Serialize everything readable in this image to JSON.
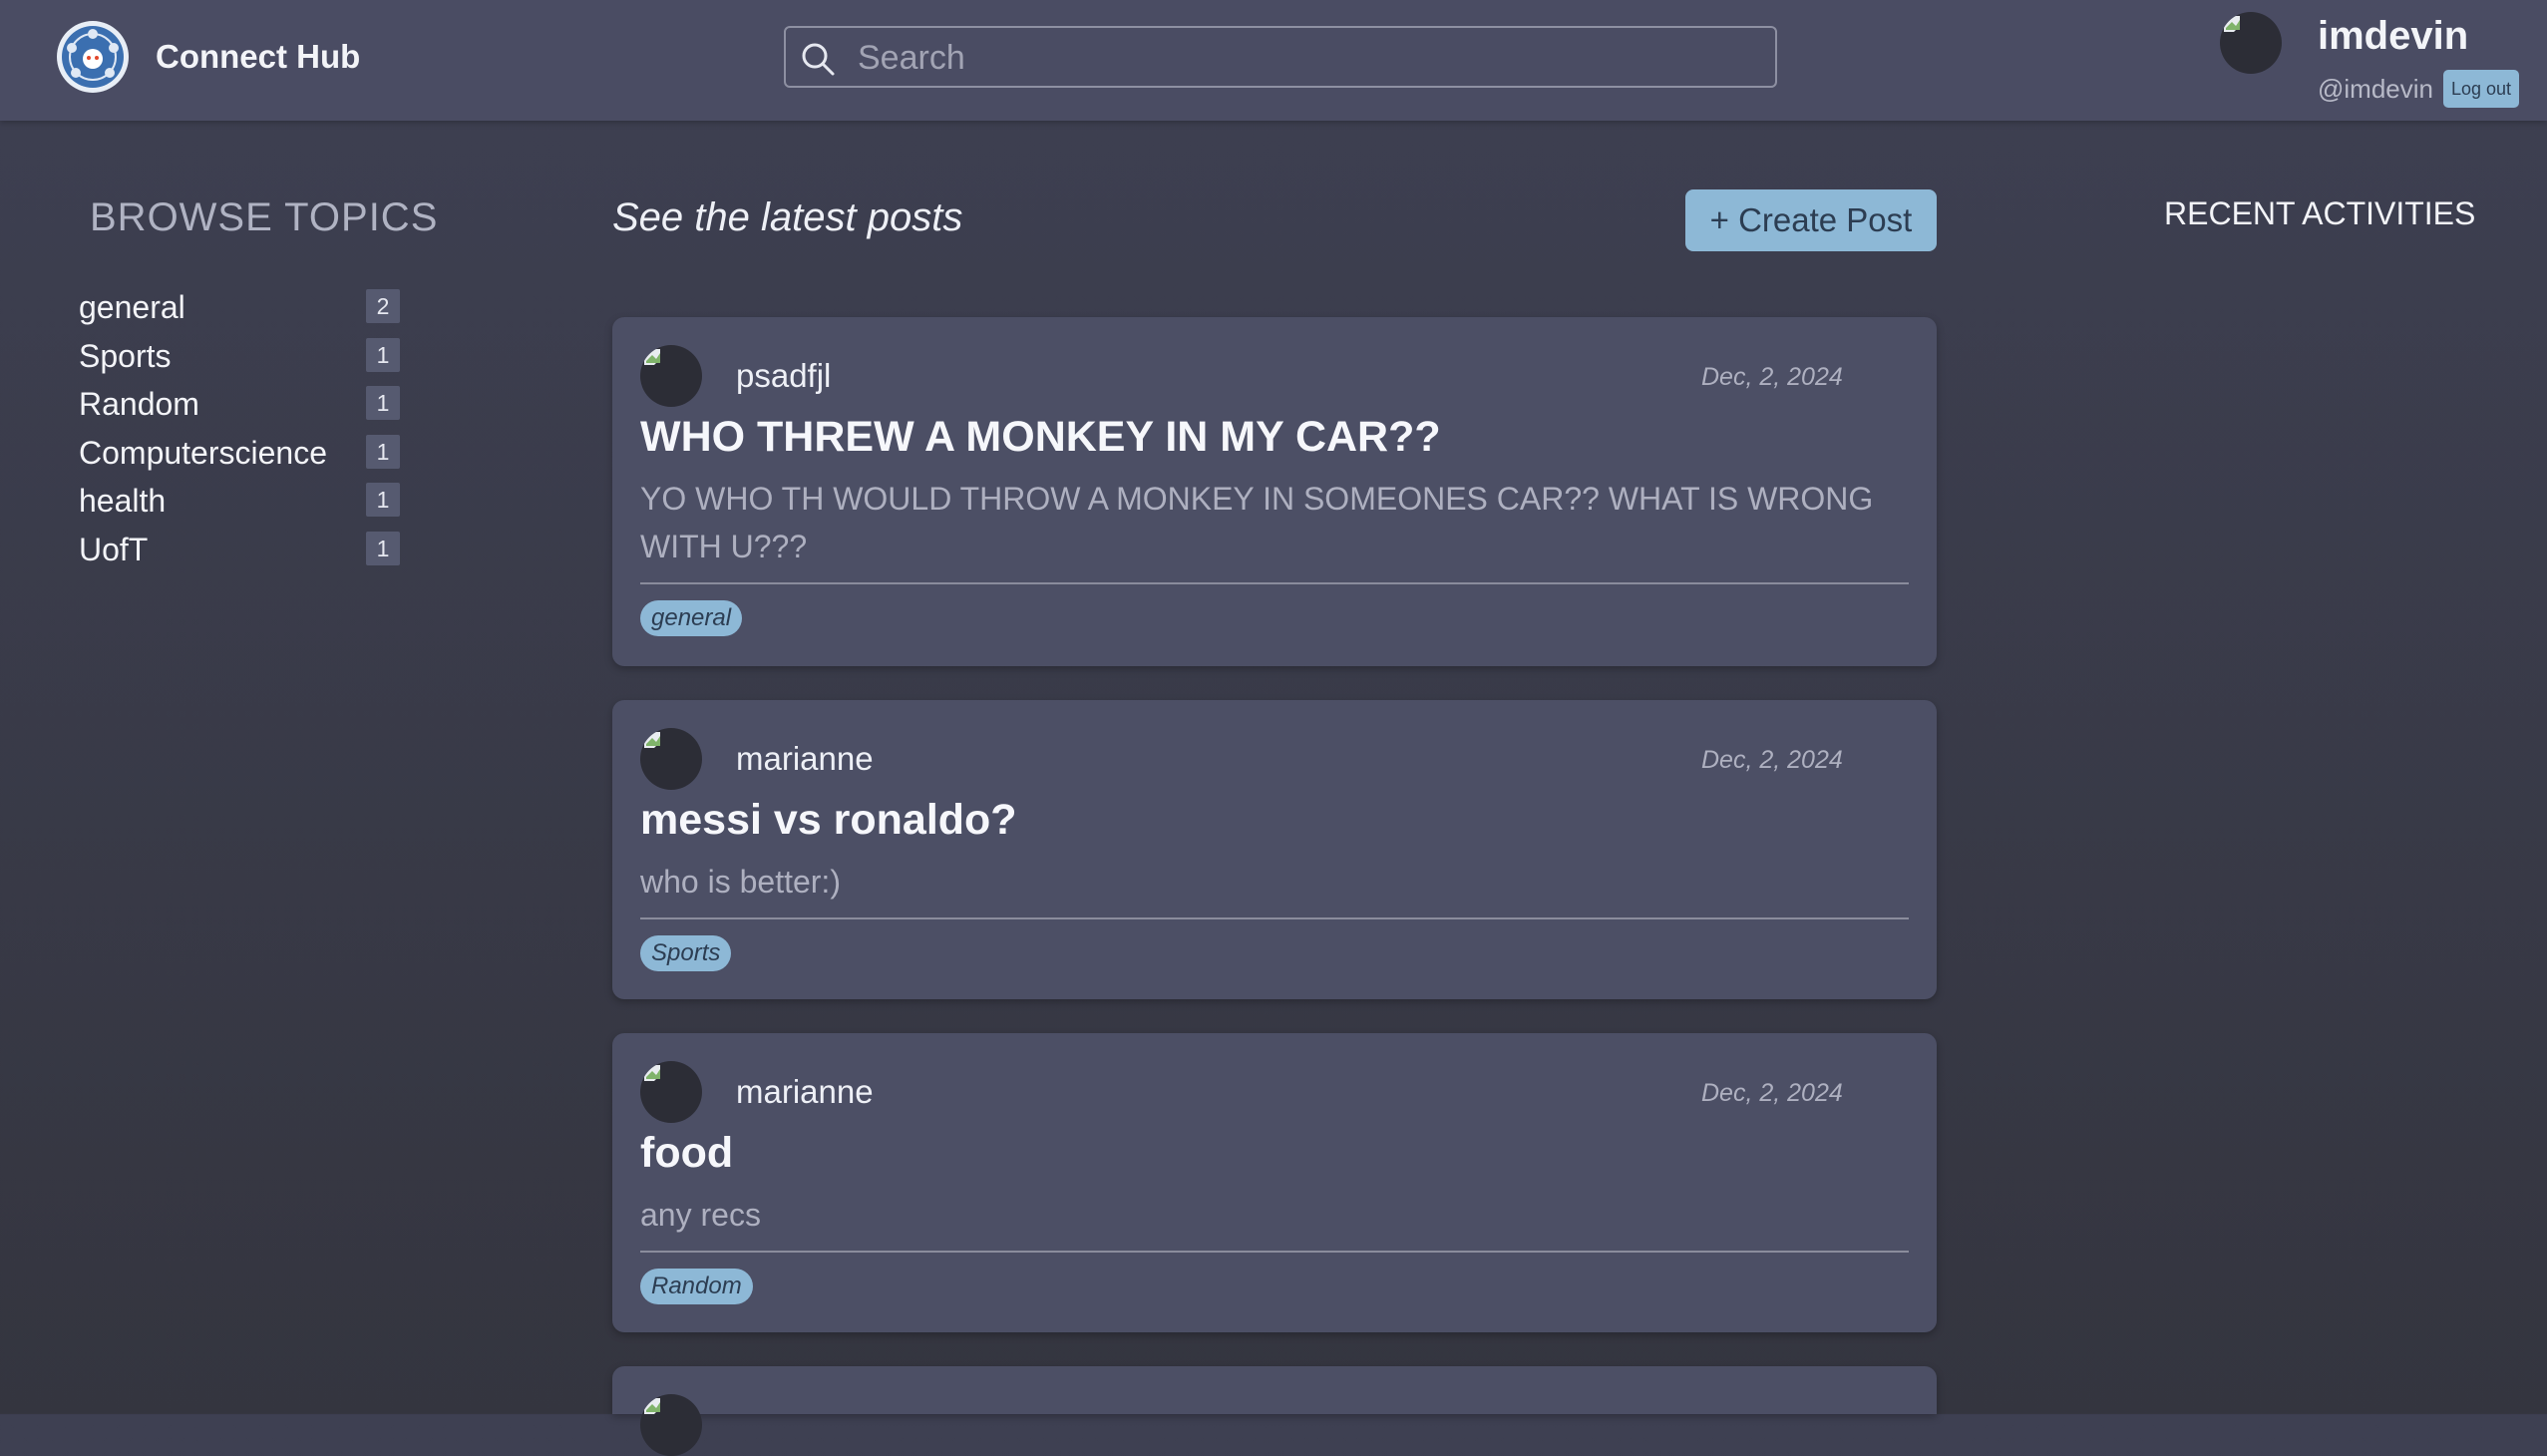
{
  "header": {
    "brand": "Connect Hub",
    "search_placeholder": "Search",
    "user": {
      "name": "imdevin",
      "handle": "@imdevin",
      "logout_label": "Log out"
    }
  },
  "sidebar": {
    "title": "BROWSE TOPICS",
    "topics": [
      {
        "name": "general",
        "count": "2"
      },
      {
        "name": "Sports",
        "count": "1"
      },
      {
        "name": "Random",
        "count": "1"
      },
      {
        "name": "Computerscience",
        "count": "1"
      },
      {
        "name": "health",
        "count": "1"
      },
      {
        "name": "UofT",
        "count": "1"
      }
    ]
  },
  "feed": {
    "title": "See the latest posts",
    "create_label": "+ Create Post",
    "posts": [
      {
        "author": "psadfjl",
        "date": "Dec, 2, 2024",
        "title": "WHO THREW A MONKEY IN MY CAR??",
        "body": "YO WHO TH WOULD THROW A MONKEY IN SOMEONES CAR?? WHAT IS WRONG WITH U???",
        "tag": "general"
      },
      {
        "author": "marianne",
        "date": "Dec, 2, 2024",
        "title": "messi vs ronaldo?",
        "body": "who is better:)",
        "tag": "Sports"
      },
      {
        "author": "marianne",
        "date": "Dec, 2, 2024",
        "title": "food",
        "body": "any recs",
        "tag": "Random"
      }
    ]
  },
  "activity": {
    "title": "RECENT ACTIVITIES"
  },
  "colors": {
    "accent": "#8db8d6",
    "card": "#4c4f65",
    "header": "#4a4c63"
  }
}
